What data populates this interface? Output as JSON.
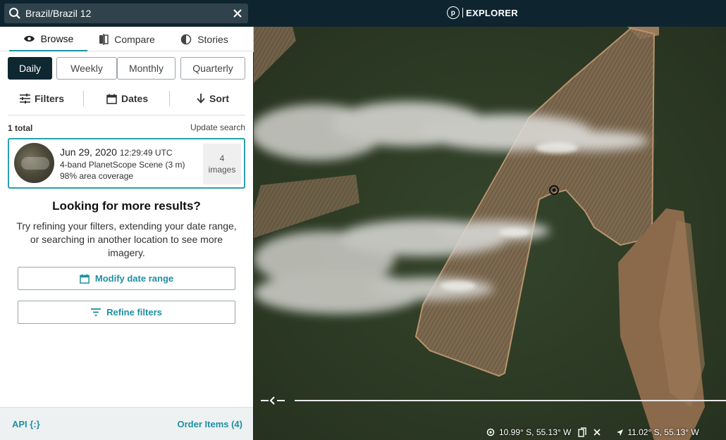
{
  "search": {
    "query": "Brazil/Brazil 12"
  },
  "brand": {
    "logo_letter": "p",
    "name": "EXPLORER"
  },
  "tabs": [
    {
      "label": "Browse",
      "icon": "eye-icon"
    },
    {
      "label": "Compare",
      "icon": "compare-icon"
    },
    {
      "label": "Stories",
      "icon": "stories-icon"
    }
  ],
  "intervals": [
    "Daily",
    "Weekly",
    "Monthly",
    "Quarterly"
  ],
  "toolbar": {
    "filters": "Filters",
    "dates": "Dates",
    "sort": "Sort"
  },
  "results": {
    "total": "1 total",
    "update": "Update search",
    "card": {
      "date": "Jun 29, 2020",
      "time": "12:29:49 UTC",
      "desc": "4-band PlanetScope Scene (3 m)",
      "coverage": "98% area coverage",
      "count": "4",
      "count_label": "images"
    }
  },
  "more": {
    "heading": "Looking for more results?",
    "text": "Try refining your filters, extending your date range, or searching in another location to see more imagery.",
    "modify_label": "Modify date range",
    "refine_label": "Refine filters"
  },
  "footer": {
    "api": "API {:}",
    "order": "Order Items (4)"
  },
  "map": {
    "center_coords": "10.99° S, 55.13° W",
    "cursor_coords": "11.02° S, 55.13° W"
  },
  "colors": {
    "accent": "#1e8fa3",
    "topbar": "#0e2530",
    "selected": "#0f2731"
  }
}
